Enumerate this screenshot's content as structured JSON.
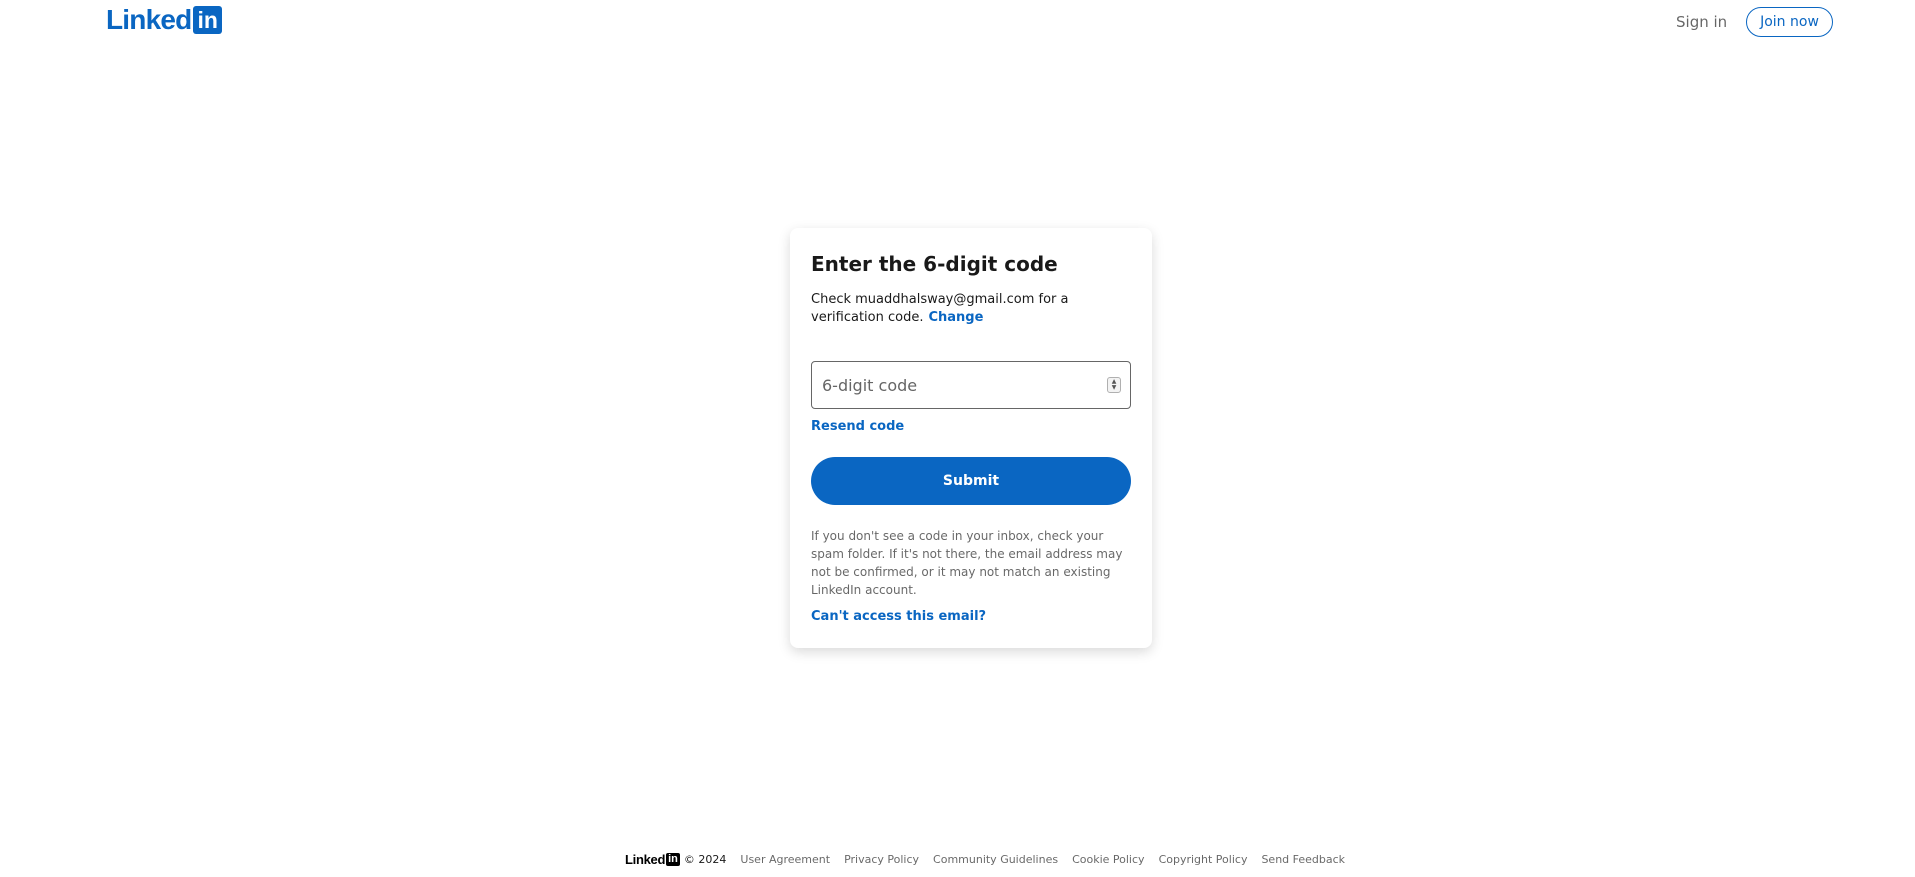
{
  "header": {
    "logo_text": "Linked",
    "logo_box": "in",
    "sign_in": "Sign in",
    "join_now": "Join now"
  },
  "card": {
    "title": "Enter the 6-digit code",
    "desc_prefix": "Check ",
    "email": "muaddhalsway@gmail.com",
    "desc_suffix": " for a verification code.",
    "change_link": "Change",
    "input_placeholder": "6-digit code",
    "input_value": "",
    "resend_link": "Resend code",
    "submit_label": "Submit",
    "note": "If you don't see a code in your inbox, check your spam folder. If it's not there, the email address may not be confirmed, or it may not match an existing LinkedIn account.",
    "cant_access_link": "Can't access this email?"
  },
  "footer": {
    "logo_text": "Linked",
    "logo_box": "in",
    "copyright": "© 2024",
    "links": [
      "User Agreement",
      "Privacy Policy",
      "Community Guidelines",
      "Cookie Policy",
      "Copyright Policy",
      "Send Feedback"
    ]
  },
  "colors": {
    "brand": "#0a66c2",
    "text": "#000000e6",
    "muted": "#00000099",
    "background": "#ffffff"
  },
  "icons": {
    "spinner": "number-stepper-icon"
  }
}
